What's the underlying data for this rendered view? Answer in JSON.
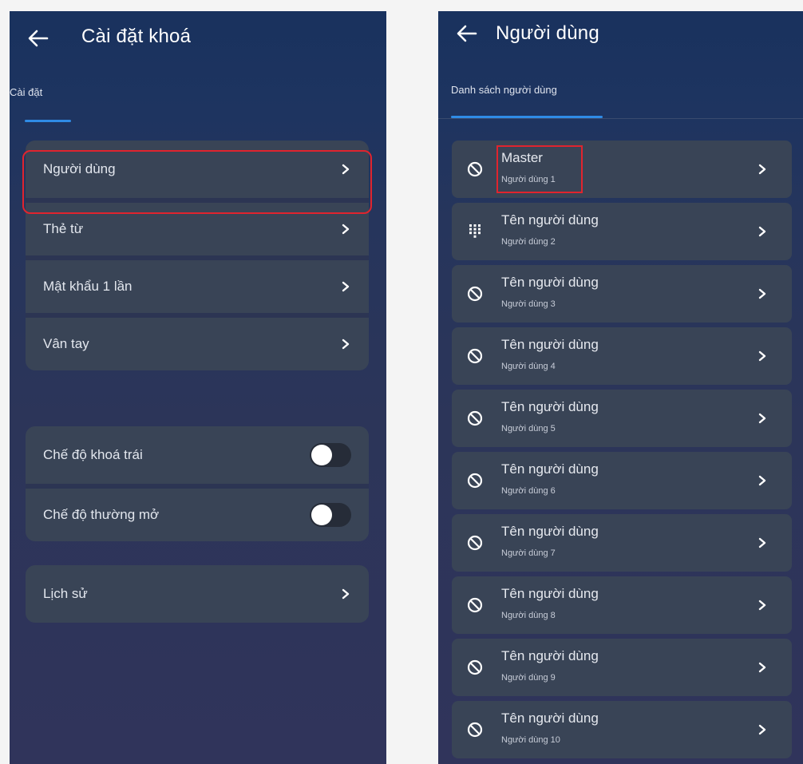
{
  "left_screen": {
    "title": "Cài đặt khoá",
    "tab": "Cài đặt",
    "group1": [
      {
        "label": "Người dùng"
      },
      {
        "label": "Thẻ từ"
      },
      {
        "label": "Mật khẩu 1 lần"
      },
      {
        "label": "Vân tay"
      }
    ],
    "group2": [
      {
        "label": "Chế độ khoá trái",
        "enabled": false
      },
      {
        "label": "Chế độ thường mở",
        "enabled": false
      }
    ],
    "group3": [
      {
        "label": "Lịch sử"
      }
    ]
  },
  "right_screen": {
    "title": "Người dùng",
    "tab": "Danh sách người dùng",
    "users": [
      {
        "name": "Master",
        "sub": "Người dùng 1",
        "icon": "block-icon"
      },
      {
        "name": "Tên người dùng",
        "sub": "Người dùng 2",
        "icon": "keypad-icon"
      },
      {
        "name": "Tên người dùng",
        "sub": "Người dùng 3",
        "icon": "block-icon"
      },
      {
        "name": "Tên người dùng",
        "sub": "Người dùng 4",
        "icon": "block-icon"
      },
      {
        "name": "Tên người dùng",
        "sub": "Người dùng 5",
        "icon": "block-icon"
      },
      {
        "name": "Tên người dùng",
        "sub": "Người dùng 6",
        "icon": "block-icon"
      },
      {
        "name": "Tên người dùng",
        "sub": "Người dùng 7",
        "icon": "block-icon"
      },
      {
        "name": "Tên người dùng",
        "sub": "Người dùng 8",
        "icon": "block-icon"
      },
      {
        "name": "Tên người dùng",
        "sub": "Người dùng 9",
        "icon": "block-icon"
      },
      {
        "name": "Tên người dùng",
        "sub": "Người dùng 10",
        "icon": "block-icon"
      }
    ]
  },
  "colors": {
    "accent": "#2f8be6",
    "highlight": "#e0242e",
    "card": "#394456"
  }
}
